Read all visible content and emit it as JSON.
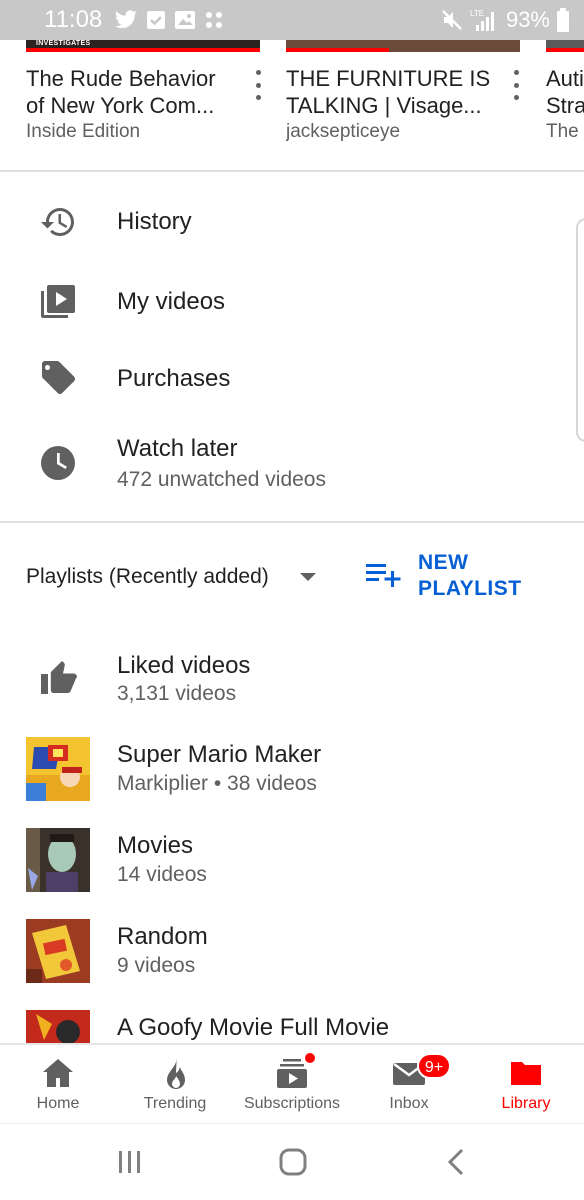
{
  "status_bar": {
    "time": "11:08",
    "left_icons": [
      "twitter-icon",
      "check-icon",
      "image-icon",
      "dots-icon"
    ],
    "battery": "93%",
    "right_icons": [
      "mute-icon",
      "lte-signal-icon",
      "battery-icon"
    ]
  },
  "recent_videos": [
    {
      "thumb_label": "INVESTIGATES",
      "title_line1": "The Rude Behavior",
      "title_line2": "of New York Com...",
      "channel": "Inside Edition"
    },
    {
      "thumb_label": "",
      "title_line1": "THE FURNITURE IS",
      "title_line2": "TALKING | Visage...",
      "channel": "jacksepticeye"
    },
    {
      "thumb_label": "",
      "title_line1": "Auti",
      "title_line2": "Stra",
      "channel": "The V"
    }
  ],
  "library_menu": {
    "history": "History",
    "my_videos": "My videos",
    "purchases": "Purchases",
    "watch_later": "Watch later",
    "watch_later_sub": "472 unwatched videos"
  },
  "playlists": {
    "header": "Playlists (Recently added)",
    "new_playlist_line1": "NEW",
    "new_playlist_line2": "PLAYLIST",
    "items": [
      {
        "title": "Liked videos",
        "meta": "3,131 videos"
      },
      {
        "title": "Super Mario Maker",
        "meta": "Markiplier • 38 videos"
      },
      {
        "title": "Movies",
        "meta": "14 videos"
      },
      {
        "title": "Random",
        "meta": "9 videos"
      },
      {
        "title": "A Goofy Movie Full Movie",
        "meta": ""
      }
    ]
  },
  "bottom_nav": {
    "home": "Home",
    "trending": "Trending",
    "subscriptions": "Subscriptions",
    "inbox": "Inbox",
    "inbox_badge": "9+",
    "library": "Library"
  },
  "colors": {
    "accent_red": "#ff0000",
    "link_blue": "#065fd4",
    "icon_gray": "#606060"
  }
}
